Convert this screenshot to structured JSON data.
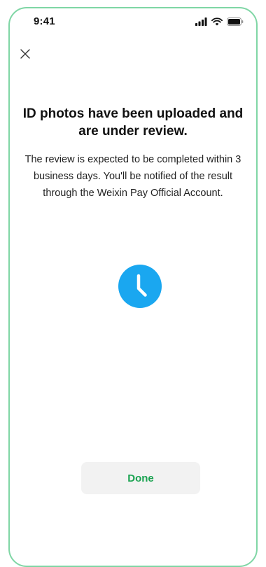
{
  "status_bar": {
    "time": "9:41",
    "icons": [
      "signal-icon",
      "wifi-icon",
      "battery-icon"
    ]
  },
  "header": {
    "close_icon": "close-icon"
  },
  "main": {
    "title": "ID photos have been uploaded and are under review.",
    "description": "The review is expected to be completed within 3 business days. You'll be notified of the result through the Weixin Pay Official Account.",
    "status_icon": "clock-icon"
  },
  "footer": {
    "done_label": "Done"
  },
  "colors": {
    "accent_green": "#1aa351",
    "clock_blue": "#1aa7f0",
    "frame_green": "#7fd6a5",
    "button_bg": "#f2f2f2"
  }
}
